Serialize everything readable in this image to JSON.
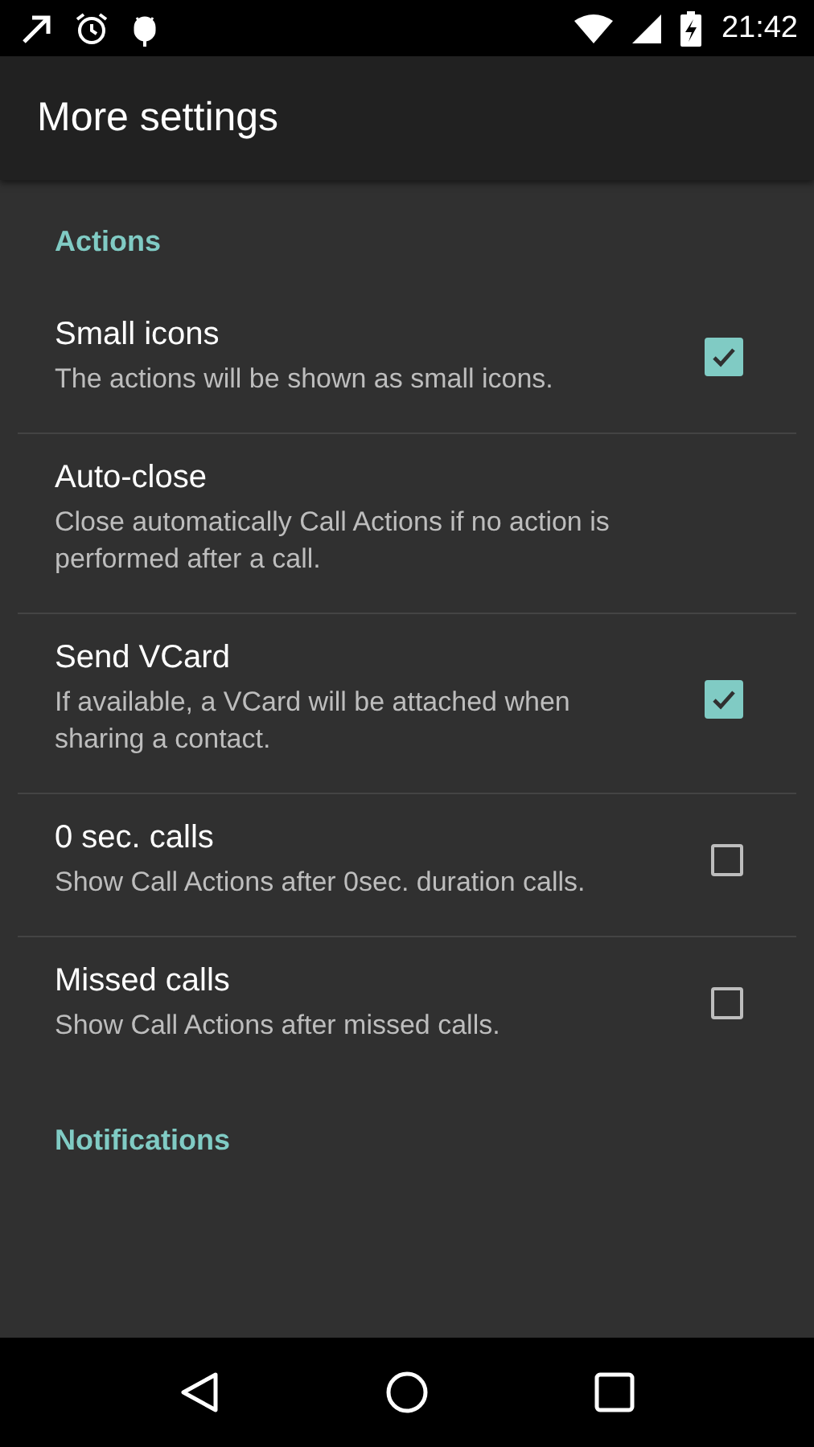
{
  "status_bar": {
    "time": "21:42"
  },
  "app_bar": {
    "title": "More settings"
  },
  "sections": [
    {
      "title": "Actions",
      "items": [
        {
          "kind": "checkbox",
          "title": "Small icons",
          "summary": "The actions will be shown as small icons.",
          "checked": true
        },
        {
          "kind": "plain",
          "title": "Auto-close",
          "summary": "Close automatically Call Actions if no action is performed after a call."
        },
        {
          "kind": "checkbox",
          "title": "Send VCard",
          "summary": "If available, a VCard will be attached when sharing a contact.",
          "checked": true
        },
        {
          "kind": "checkbox",
          "title": "0 sec. calls",
          "summary": "Show Call Actions after 0sec. duration calls.",
          "checked": false
        },
        {
          "kind": "checkbox",
          "title": "Missed calls",
          "summary": "Show Call Actions after missed calls.",
          "checked": false
        }
      ]
    },
    {
      "title": "Notifications"
    }
  ]
}
